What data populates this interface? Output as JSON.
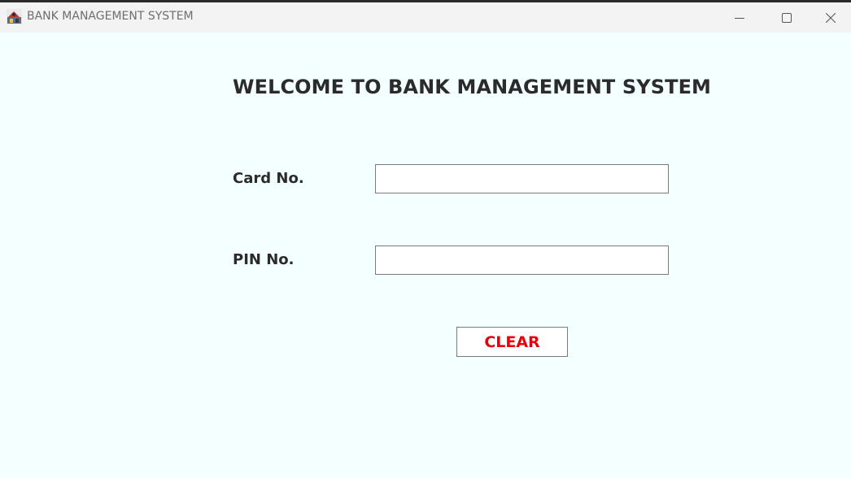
{
  "window": {
    "title": "BANK MANAGEMENT SYSTEM",
    "controls": {
      "minimize": "minimize-icon",
      "maximize": "maximize-icon",
      "close": "close-icon"
    }
  },
  "main": {
    "heading": "WELCOME TO BANK MANAGEMENT SYSTEM",
    "card_label": "Card No.",
    "card_value": "",
    "pin_label": "PIN No.",
    "pin_value": "",
    "clear_button": "CLEAR"
  },
  "colors": {
    "background": "#f4ffff",
    "titlebar": "#f3f3f3",
    "text": "#2b2b2b",
    "button_text": "#e8000b"
  }
}
